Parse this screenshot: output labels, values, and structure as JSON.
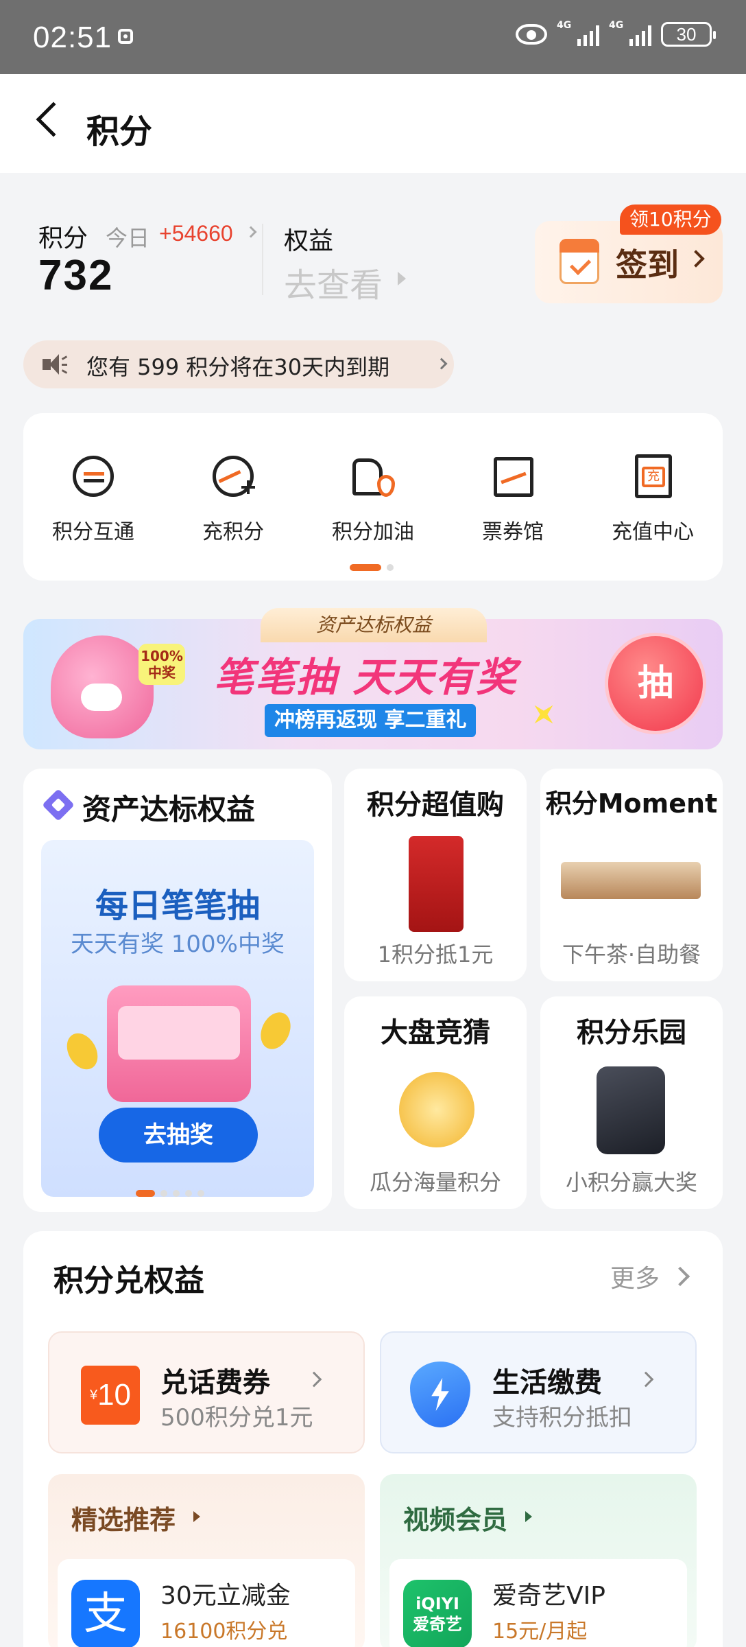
{
  "status_bar": {
    "time": "02:51",
    "net1": "4G",
    "net2": "4G",
    "battery": "30"
  },
  "header": {
    "title": "积分"
  },
  "summary": {
    "points_label": "积分",
    "today_label": "今日",
    "today_value": "+54660",
    "points_value": "732",
    "rights_label": "权益",
    "rights_link": "去查看",
    "checkin_label": "签到",
    "checkin_badge": "领10积分"
  },
  "expire_notice": "您有 599 积分将在30天内到期",
  "quick_nav": [
    {
      "label": "积分互通",
      "icon": "exchange-icon"
    },
    {
      "label": "充积分",
      "icon": "recharge-points-icon"
    },
    {
      "label": "积分加油",
      "icon": "fuel-icon"
    },
    {
      "label": "票券馆",
      "icon": "ticket-icon"
    },
    {
      "label": "充值中心",
      "icon": "topup-icon"
    }
  ],
  "banner": {
    "tab": "资产达标权益",
    "badge": "100%\n中奖",
    "title": "笔笔抽 天天有奖",
    "subtitle": "冲榜再返现 享二重礼",
    "button": "抽"
  },
  "promo": {
    "big": {
      "title": "资产达标权益",
      "headline": "每日笔笔抽",
      "subline": "天天有奖 100%中奖",
      "cta": "去抽奖"
    },
    "cards": [
      {
        "title": "积分超值购",
        "sub": "1积分抵1元"
      },
      {
        "title": "积分Moment",
        "sub": "下午茶·自助餐"
      },
      {
        "title": "大盘竞猜",
        "sub": "瓜分海量积分"
      },
      {
        "title": "积分乐园",
        "sub": "小积分赢大奖"
      }
    ]
  },
  "exchange": {
    "title": "积分兑权益",
    "more": "更多",
    "tiles": [
      {
        "title": "兑话费券",
        "sub": "500积分兑1元",
        "icon_value": "10",
        "icon_prefix": "¥"
      },
      {
        "title": "生活缴费",
        "sub": "支持积分抵扣"
      }
    ],
    "recommend": [
      {
        "header": "精选推荐",
        "name": "30元立减金",
        "price": "16100积分兑",
        "logo": "支"
      },
      {
        "header": "视频会员",
        "name": "爱奇艺VIP",
        "price": "15元/月起",
        "logo": "iQIYI\n爱奇艺"
      }
    ]
  },
  "colors": {
    "accent": "#f06a24",
    "red": "#e8432f",
    "blue": "#1767e6"
  }
}
